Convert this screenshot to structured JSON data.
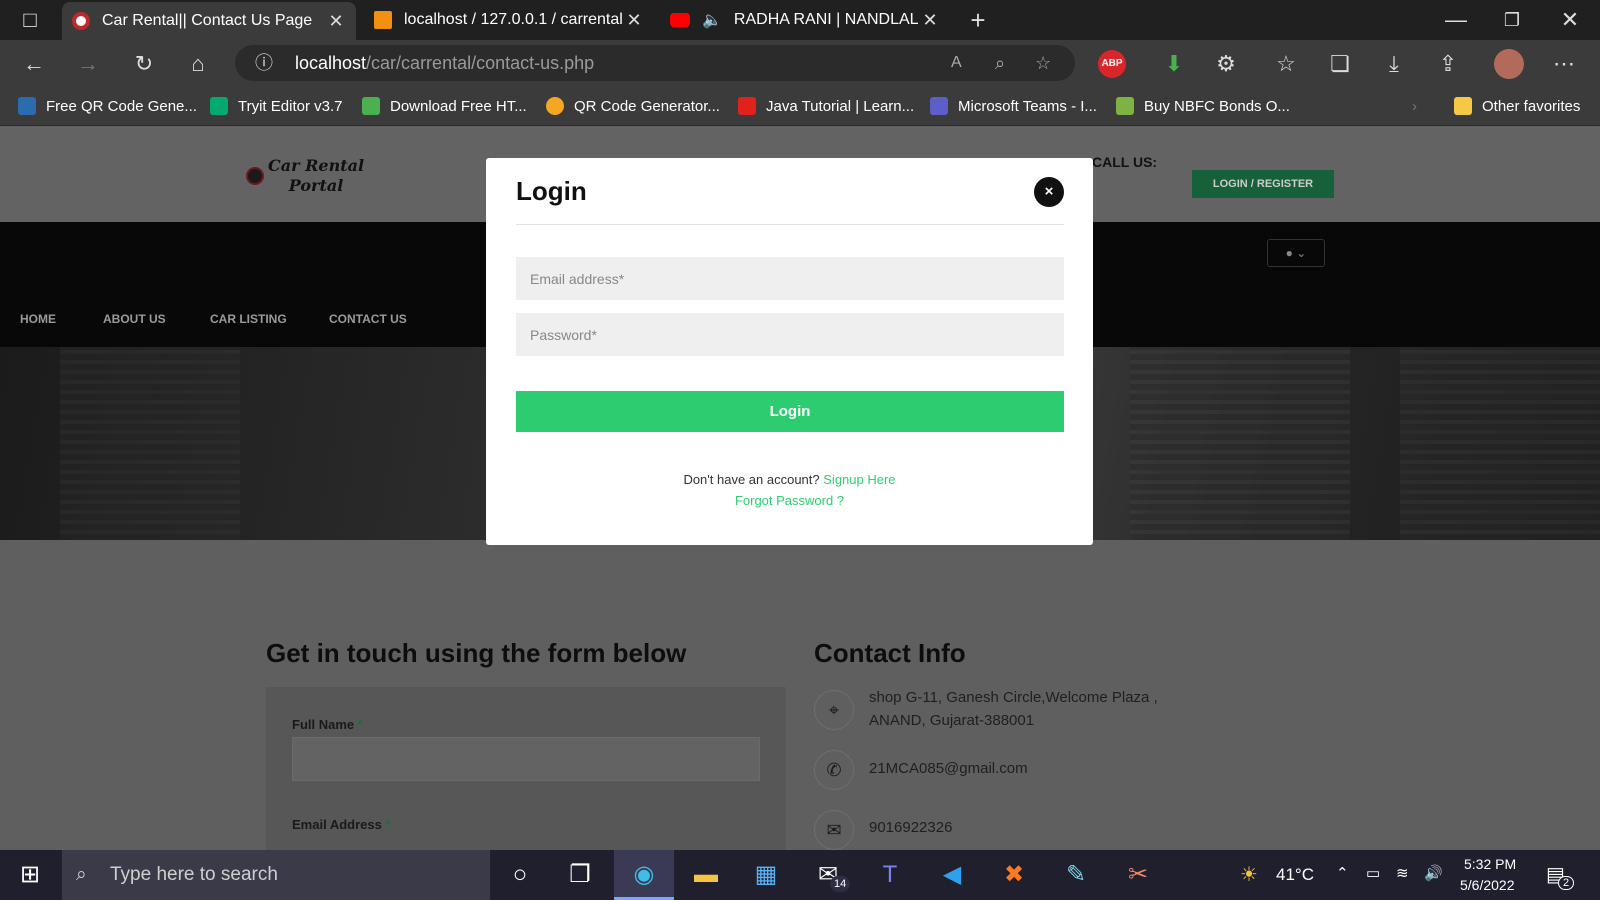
{
  "browser": {
    "tabs": [
      {
        "title": "Car Rental|| Contact Us Page",
        "active": true
      },
      {
        "title": "localhost / 127.0.0.1 / carrental |",
        "active": false
      },
      {
        "title": "RADHA RANI | NANDLAL CH",
        "active": false
      }
    ],
    "url_host": "localhost",
    "url_path": "/car/carrental/contact-us.php",
    "abp_label": "ABP",
    "bookmarks": [
      "Free QR Code Gene...",
      "Tryit Editor v3.7",
      "Download Free HT...",
      "QR Code Generator...",
      "Java Tutorial | Learn...",
      "Microsoft Teams - I...",
      "Buy NBFC Bonds O..."
    ],
    "other_favorites": "Other favorites"
  },
  "site": {
    "logo_line1": "Car Rental",
    "logo_line2": "Portal",
    "call_us": "CALL US:",
    "login_register": "LOGIN / REGISTER",
    "nav": [
      "HOME",
      "ABOUT US",
      "CAR LISTING",
      "CONTACT US"
    ],
    "form_heading": "Get in touch using the form below",
    "full_name_label": "Full Name",
    "email_label": "Email Address",
    "required_mark": "*",
    "contact_heading": "Contact Info",
    "address_line1": "shop G-11, Ganesh Circle,Welcome Plaza ,",
    "address_line2": "ANAND, Gujarat-388001",
    "email": "21MCA085@gmail.com",
    "phone": "9016922326"
  },
  "modal": {
    "title": "Login",
    "close": "×",
    "email_placeholder": "Email address*",
    "password_placeholder": "Password*",
    "login_button": "Login",
    "no_account": "Don't have an account?",
    "signup": "Signup Here",
    "forgot": "Forgot Password ?"
  },
  "taskbar": {
    "search_placeholder": "Type here to search",
    "mail_badge": "14",
    "temperature": "41°C",
    "time": "5:32 PM",
    "date": "5/6/2022",
    "notification_count": "2"
  },
  "colors": {
    "accent_green": "#2ecc71",
    "dark_green": "#16603a"
  }
}
